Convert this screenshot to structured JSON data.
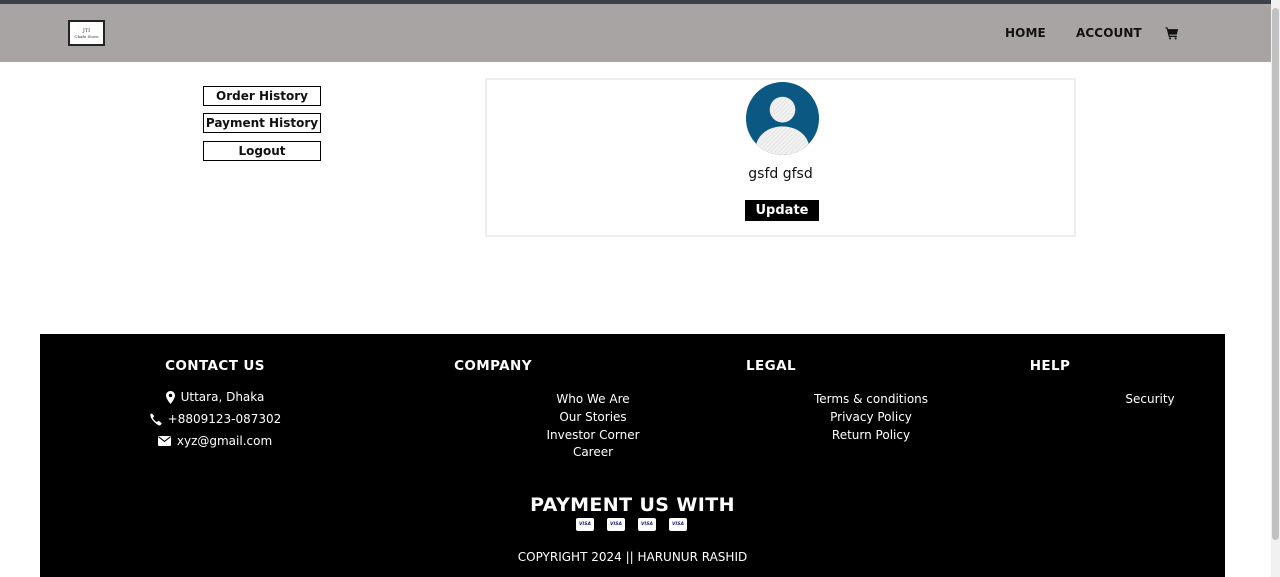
{
  "header": {
    "logo_mark": "JTI",
    "logo_name": "Chafe Store",
    "nav": [
      {
        "label": "HOME"
      },
      {
        "label": "ACCOUNT"
      }
    ],
    "cart_icon": "cart-icon"
  },
  "sidebar": {
    "buttons": [
      {
        "label": "Order History"
      },
      {
        "label": "Payment History"
      },
      {
        "label": "Logout"
      }
    ]
  },
  "profile": {
    "avatar_icon": "user-avatar-icon",
    "name": "gsfd gfsd",
    "update_label": "Update",
    "accent": "#0b5883"
  },
  "footer": {
    "contact": {
      "heading": "CONTACT US",
      "address": "Uttara, Dhaka",
      "phone": "+8809123-087302",
      "email": "xyz@gmail.com"
    },
    "company": {
      "heading": "COMPANY",
      "links": [
        "Who We Are",
        "Our Stories",
        "Investor Corner",
        "Career"
      ]
    },
    "legal": {
      "heading": "LEGAL",
      "links": [
        "Terms & conditions",
        "Privacy Policy",
        "Return Policy"
      ]
    },
    "help": {
      "heading": "HELP",
      "links": [
        "Security"
      ]
    },
    "payment_heading": "PAYMENT US WITH",
    "card_label": "VISA",
    "copyright": "COPYRIGHT 2024 || HARUNUR RASHID"
  }
}
